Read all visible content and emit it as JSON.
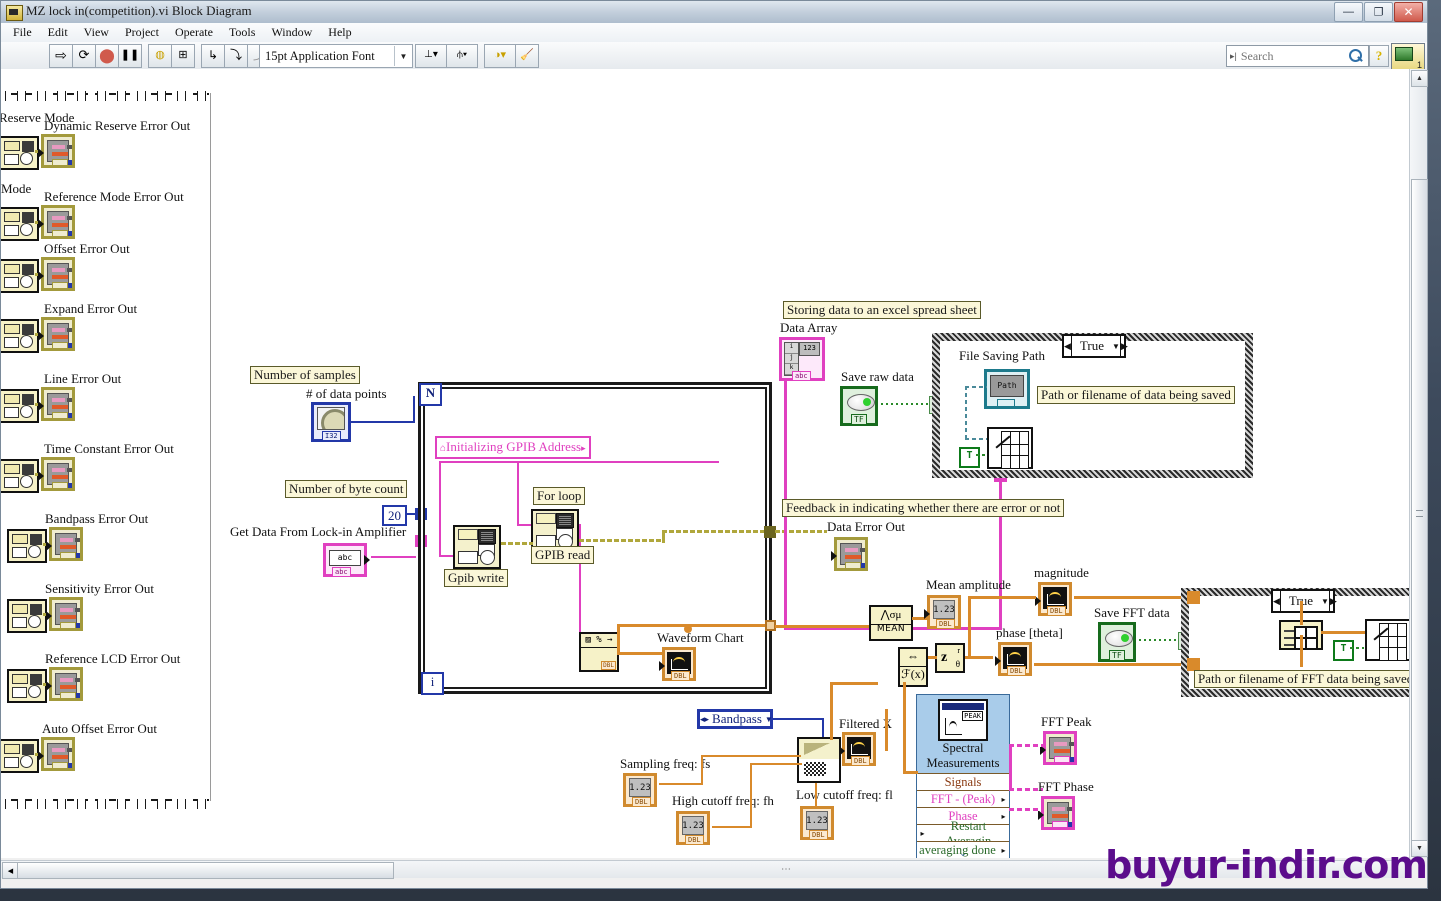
{
  "window": {
    "title": "MZ lock in(competition).vi Block Diagram",
    "icon": "labview-vi-icon",
    "buttons": {
      "minimize": "—",
      "restore": "❐",
      "close": "✕"
    }
  },
  "menu": {
    "items": [
      "File",
      "Edit",
      "View",
      "Project",
      "Operate",
      "Tools",
      "Window",
      "Help"
    ]
  },
  "toolbar": {
    "buttons": [
      {
        "name": "run-button",
        "glyph": "⇨"
      },
      {
        "name": "run-continuously-button",
        "glyph": "⟳"
      },
      {
        "name": "abort-execution-button",
        "glyph": "⬤"
      },
      {
        "name": "pause-button",
        "glyph": "❚❚"
      },
      {
        "name": "highlight-execution-button",
        "glyph": "💡"
      },
      {
        "name": "retain-wire-values-button",
        "glyph": "⊞"
      },
      {
        "name": "step-into-button",
        "glyph": "↳"
      },
      {
        "name": "step-over-button",
        "glyph": "⤵"
      },
      {
        "name": "step-out-button",
        "glyph": "⤴"
      }
    ],
    "font_selector": "15pt Application Font",
    "align_objects": "align-objects-button",
    "distribute_objects": "distribute-objects-button",
    "reorder": "reorder-button",
    "clean_up_diagram": "clean-up-diagram-button",
    "search_placeholder": "Search",
    "help_label": "?",
    "vi_badge": "1"
  },
  "statusbar": {
    "watermark": "buyur-indir.com"
  },
  "diagram": {
    "left_panel": {
      "partial_labels": [
        "Reserve Mode",
        "Mode"
      ],
      "indicators": [
        {
          "label": "Dynamic Reserve Error Out"
        },
        {
          "label": "Reference Mode Error Out"
        },
        {
          "label": "Offset Error Out"
        },
        {
          "label": "Expand Error Out"
        },
        {
          "label": "Line Error Out"
        },
        {
          "label": "Time Constant Error Out"
        },
        {
          "label": "Bandpass Error Out"
        },
        {
          "label": "Sensitivity Error Out"
        },
        {
          "label": "Reference LCD Error Out"
        },
        {
          "label": "Auto Offset  Error Out"
        }
      ]
    },
    "acquisition": {
      "free_label_samples": "Number of samples",
      "data_points_label": "# of data points",
      "free_label_byte_count": "Number of byte count",
      "byte_count_value": "20",
      "lockin_label": "Get Data From Lock-in Amplifier",
      "lockin_string_value": "abc",
      "lockin_string_type": "abc",
      "subdiagram_label": "Initializing GPIB Address",
      "gpib_write_label": "Gpib write",
      "gpib_read_label": "GPIB read",
      "for_loop_label": "For loop",
      "loop_count_terminal": "N",
      "loop_index_terminal": "i",
      "waveform_chart_label": "Waveform Chart"
    },
    "storing": {
      "free_label": "Storing data to an excel spread sheet",
      "data_array_label": "Data Array",
      "data_array_value": "123",
      "save_raw_data_label": "Save raw data",
      "save_raw_data_state": "TF",
      "case_value": "True",
      "file_saving_path_label": "File Saving Path",
      "path_value": "Path",
      "path_note": "Path or filename of data being saved",
      "true_constant": "T"
    },
    "feedback": {
      "free_label": "Feedback in indicating whether there are error or not",
      "data_error_out_label": "Data Error Out"
    },
    "analysis": {
      "mean_amplitude_label": "Mean amplitude",
      "mean_amplitude_value": "1.23",
      "mean_node_symbol": "⋀σμ",
      "mean_node_label": "MEAN",
      "magnitude_label": "magnitude",
      "phase_label": "phase [theta]",
      "z_node_real": "r",
      "z_node_theta": "θ",
      "z_node_symbol": "z",
      "fx_node_symbol": "ℱ(x)",
      "fx_node_top": "⇔",
      "save_fft_data_label": "Save FFT data",
      "save_fft_state": "TF",
      "fft_case_value": "True",
      "fft_path_note": "Path or filename of FFT data being saved",
      "fft_true_constant": "T"
    },
    "filtering": {
      "filter_type": "Bandpass",
      "filtered_x_label": "Filtered X",
      "sampling_freq_label": "Sampling freq: fs",
      "sampling_freq_value": "1.23",
      "high_cutoff_label": "High cutoff freq: fh",
      "high_cutoff_value": "1.23",
      "low_cutoff_label": "Low cutoff freq: fl",
      "low_cutoff_value": "1.23"
    },
    "spectral": {
      "title_line1": "Spectral",
      "title_line2": "Measurements",
      "rows": [
        "Signals",
        "FFT - (Peak)",
        "Phase",
        "Restart Averagin",
        "averaging done"
      ],
      "fft_peak_label": "FFT Peak",
      "fft_phase_label": "FFT Phase"
    }
  },
  "colors": {
    "wire_orange": "#d98a2b",
    "wire_pink": "#e040c0",
    "wire_blue": "#2338a8",
    "wire_error": "#b0a73c",
    "express_blue": "#a9ccea",
    "watermark_purple": "#5b0d8c"
  }
}
